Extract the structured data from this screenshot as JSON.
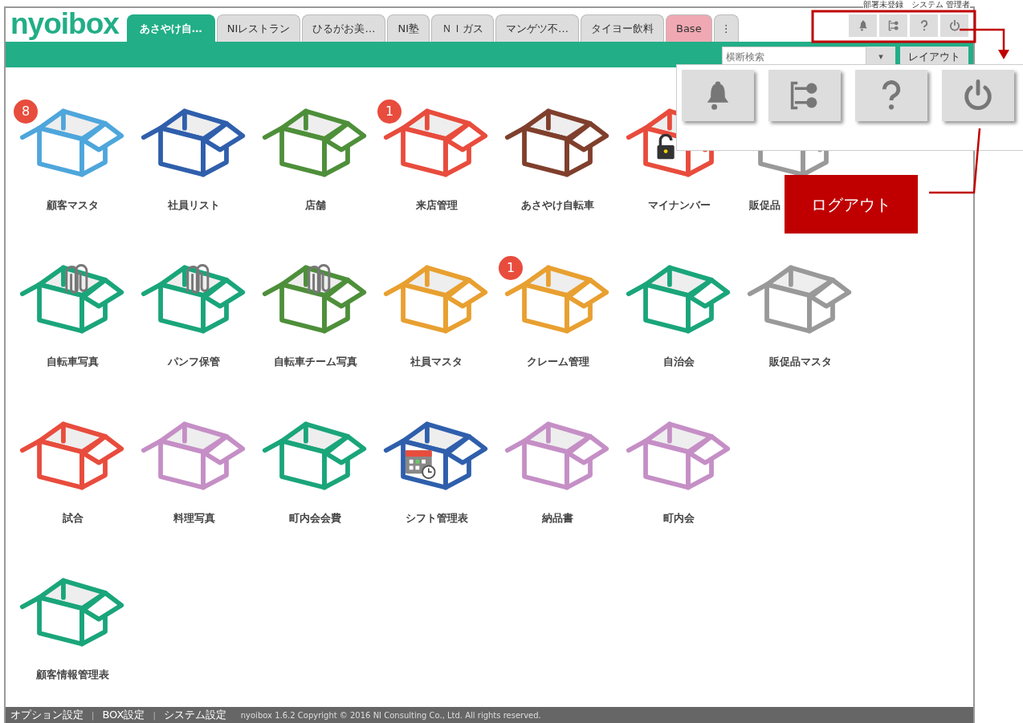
{
  "header": {
    "user": "部署未登録　システム 管理者",
    "logo": "nyoibox"
  },
  "tabs": [
    {
      "label": "あさやけ自…",
      "kind": "normal",
      "selected": true
    },
    {
      "label": "NIレストラン",
      "kind": "normal",
      "selected": false
    },
    {
      "label": "ひるがお美…",
      "kind": "normal",
      "selected": false
    },
    {
      "label": "NI塾",
      "kind": "normal",
      "selected": false
    },
    {
      "label": "ＮＩガス",
      "kind": "normal",
      "selected": false
    },
    {
      "label": "マンゲツ不…",
      "kind": "normal",
      "selected": false
    },
    {
      "label": "タイヨー飲料",
      "kind": "normal",
      "selected": false
    },
    {
      "label": "Base",
      "kind": "base",
      "selected": false
    },
    {
      "label": "⋮",
      "kind": "more",
      "selected": false
    }
  ],
  "search": {
    "placeholder": "横断検索",
    "dropdown": "▾",
    "layout_button": "レイアウト"
  },
  "boxes": [
    [
      {
        "label": "顧客マスタ",
        "color": "#4ea6dc",
        "badge": "8",
        "kind": "plain"
      },
      {
        "label": "社員リスト",
        "color": "#2f5fac",
        "kind": "plain"
      },
      {
        "label": "店舗",
        "color": "#4e8f3a",
        "kind": "plain"
      },
      {
        "label": "来店管理",
        "color": "#e84c3d",
        "badge": "1",
        "kind": "plain"
      },
      {
        "label": "あさやけ自転車",
        "color": "#7f3f2c",
        "kind": "plain"
      },
      {
        "label": "マイナンバー",
        "color": "#e84c3d",
        "kind": "lock"
      },
      {
        "label": "販促品",
        "color": "#999999",
        "kind": "plain",
        "clipped": true
      }
    ],
    [
      {
        "label": "自転車写真",
        "color": "#1aa57a",
        "kind": "clip"
      },
      {
        "label": "パンフ保管",
        "color": "#1aa57a",
        "kind": "clip"
      },
      {
        "label": "自転車チーム写真",
        "color": "#4e8f3a",
        "kind": "clip"
      },
      {
        "label": "社員マスタ",
        "color": "#e8a030",
        "kind": "plain"
      },
      {
        "label": "クレーム管理",
        "color": "#e8a030",
        "badge": "1",
        "kind": "plain"
      },
      {
        "label": "自治会",
        "color": "#1aa57a",
        "kind": "plain"
      },
      {
        "label": "販促品マスタ",
        "color": "#999999",
        "kind": "plain"
      }
    ],
    [
      {
        "label": "試合",
        "color": "#e84c3d",
        "kind": "plain"
      },
      {
        "label": "料理写真",
        "color": "#c58fc6",
        "kind": "plain"
      },
      {
        "label": "町内会会費",
        "color": "#1aa57a",
        "kind": "plain"
      },
      {
        "label": "シフト管理表",
        "color": "#2f5fac",
        "kind": "calendar"
      },
      {
        "label": "納品書",
        "color": "#c58fc6",
        "kind": "plain"
      },
      {
        "label": "町内会",
        "color": "#c58fc6",
        "kind": "plain"
      }
    ],
    [
      {
        "label": "顧客情報管理表",
        "color": "#1aa57a",
        "kind": "plain"
      }
    ]
  ],
  "footer": {
    "separator": "|",
    "links": [
      "オプション設定",
      "BOX設定",
      "システム設定"
    ],
    "copyright": "nyoibox 1.6.2 Copyright © 2016 NI Consulting Co., Ltd. All rights reserved."
  },
  "callout": {
    "label": "ログアウト"
  }
}
